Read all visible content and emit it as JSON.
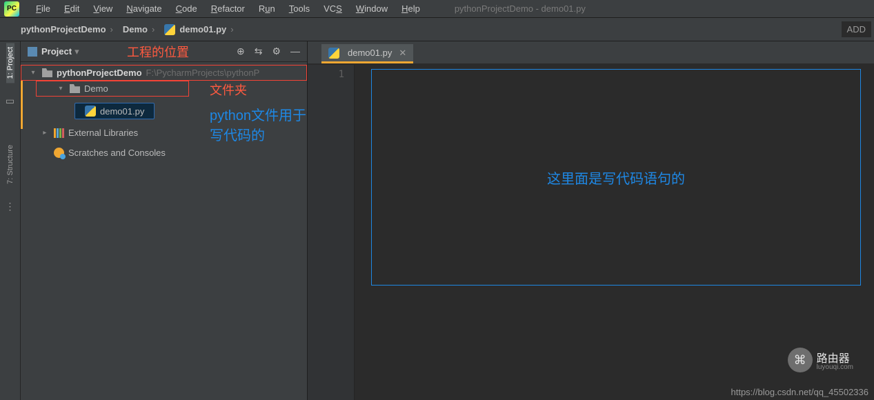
{
  "menubar": {
    "items": [
      "File",
      "Edit",
      "View",
      "Navigate",
      "Code",
      "Refactor",
      "Run",
      "Tools",
      "VCS",
      "Window",
      "Help"
    ],
    "title": "pythonProjectDemo - demo01.py"
  },
  "breadcrumb": {
    "project": "pythonProjectDemo",
    "folder": "Demo",
    "file": "demo01.py",
    "add_button": "ADD"
  },
  "sidebar": {
    "labels": {
      "project": "1: Project",
      "structure": "7: Structure"
    }
  },
  "project_panel": {
    "title": "Project",
    "root": {
      "name": "pythonProjectDemo",
      "path": "F:\\PycharmProjects\\pythonP"
    },
    "folder": {
      "name": "Demo"
    },
    "file": {
      "name": "demo01.py"
    },
    "external": "External Libraries",
    "scratches": "Scratches and Consoles"
  },
  "editor": {
    "tab": "demo01.py",
    "line1": "1"
  },
  "annotations": {
    "project_location": "工程的位置",
    "folder": "文件夹",
    "python_file": "python文件用于写代码的",
    "code_area": "这里面是写代码语句的"
  },
  "watermark": {
    "url": "https://blog.csdn.net/qq_45502336",
    "brand": "路由器",
    "brand_sub": "luyouqi.com"
  }
}
